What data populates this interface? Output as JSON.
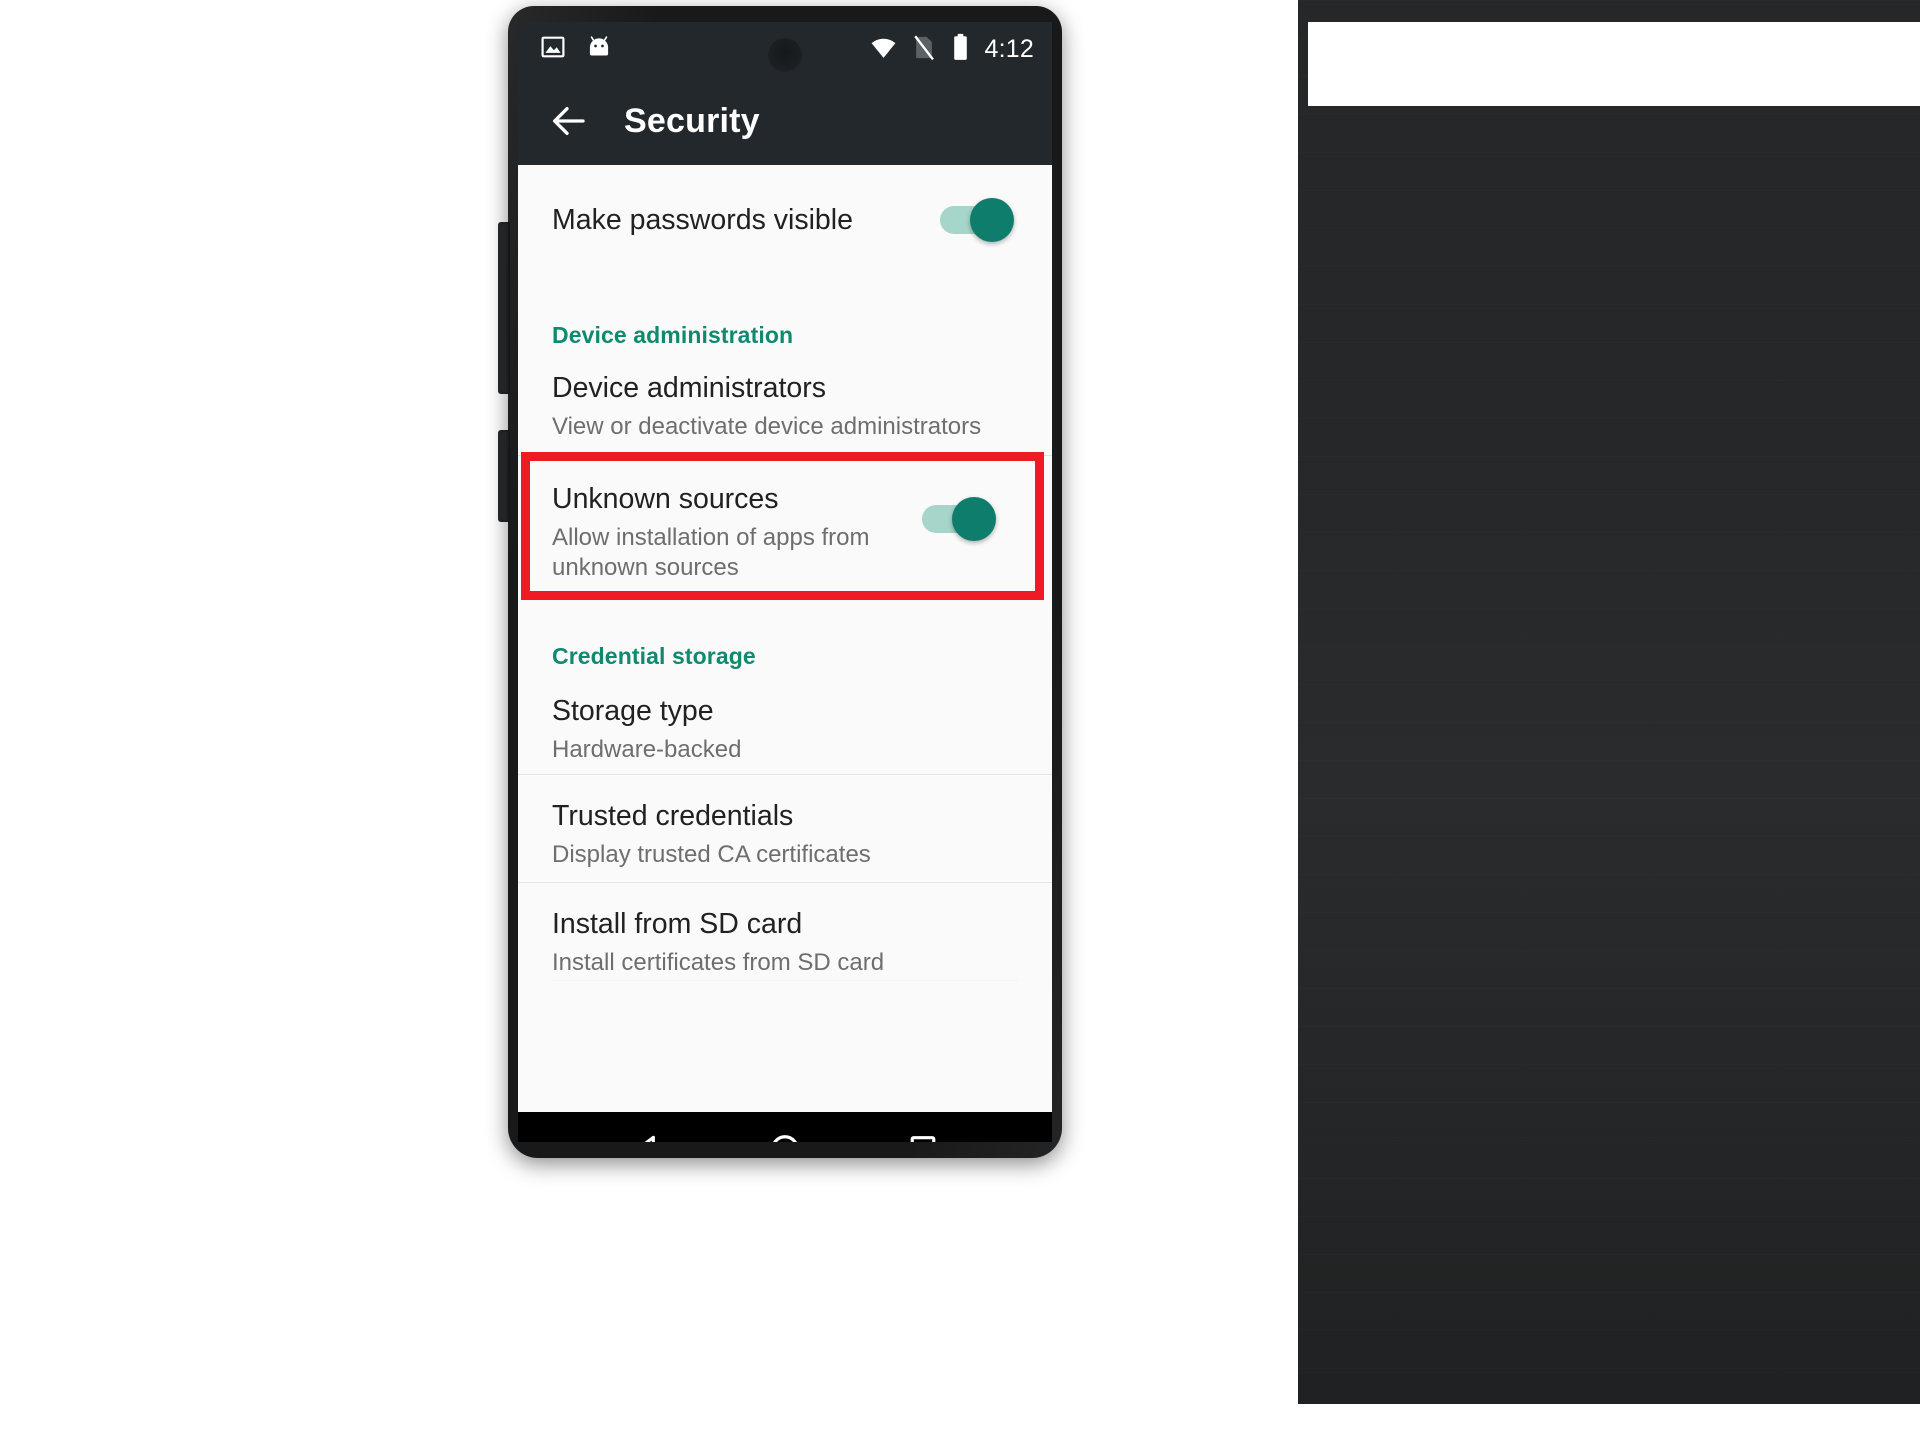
{
  "device": {
    "type": "android-phone",
    "side_buttons": [
      "volume-rocker",
      "power-button"
    ]
  },
  "status_bar": {
    "time": "4:12",
    "left_icons": [
      "screenshot-image-icon",
      "android-head-icon"
    ],
    "right_icons": [
      "wifi-icon",
      "no-sim-icon",
      "battery-icon"
    ],
    "background_color": "#22282c",
    "foreground_color": "#ffffff"
  },
  "app_bar": {
    "back_label": "Back",
    "title": "Security",
    "background_color": "#22282c"
  },
  "colors": {
    "accent_teal": "#0f8a6e",
    "toggle_on_thumb": "#0f7d6b",
    "toggle_on_track": "#a5d6c9",
    "annotation_red": "#ee1b24",
    "list_background": "#fafafa",
    "primary_text": "#212121",
    "secondary_text": "#6e6e6e"
  },
  "settings": {
    "rows": [
      {
        "id": "make-passwords-visible",
        "title": "Make passwords visible",
        "subtitle": "",
        "control": "switch",
        "switch_state": "on"
      }
    ],
    "sections": [
      {
        "id": "device-administration",
        "header": "Device administration",
        "rows": [
          {
            "id": "device-administrators",
            "title": "Device administrators",
            "subtitle": "View or deactivate device administrators",
            "control": "none"
          },
          {
            "id": "unknown-sources",
            "title": "Unknown sources",
            "subtitle": "Allow installation of apps from unknown sources",
            "control": "switch",
            "switch_state": "on",
            "highlighted": true
          }
        ]
      },
      {
        "id": "credential-storage",
        "header": "Credential storage",
        "rows": [
          {
            "id": "storage-type",
            "title": "Storage type",
            "subtitle": "Hardware-backed",
            "control": "none"
          },
          {
            "id": "trusted-credentials",
            "title": "Trusted credentials",
            "subtitle": "Display trusted CA certificates",
            "control": "none"
          },
          {
            "id": "install-from-sd-card",
            "title": "Install from SD card",
            "subtitle": "Install certificates from SD card",
            "control": "none"
          }
        ]
      }
    ]
  },
  "annotation": {
    "kind": "red-rectangle-highlight",
    "targets": "unknown-sources",
    "color": "#ee1b24"
  },
  "nav_bar": {
    "background_color": "#000000",
    "buttons": [
      {
        "id": "back",
        "icon": "triangle-back-icon",
        "label": "Back"
      },
      {
        "id": "home",
        "icon": "circle-home-icon",
        "label": "Home"
      },
      {
        "id": "recents",
        "icon": "square-recents-icon",
        "label": "Recent apps"
      }
    ]
  }
}
